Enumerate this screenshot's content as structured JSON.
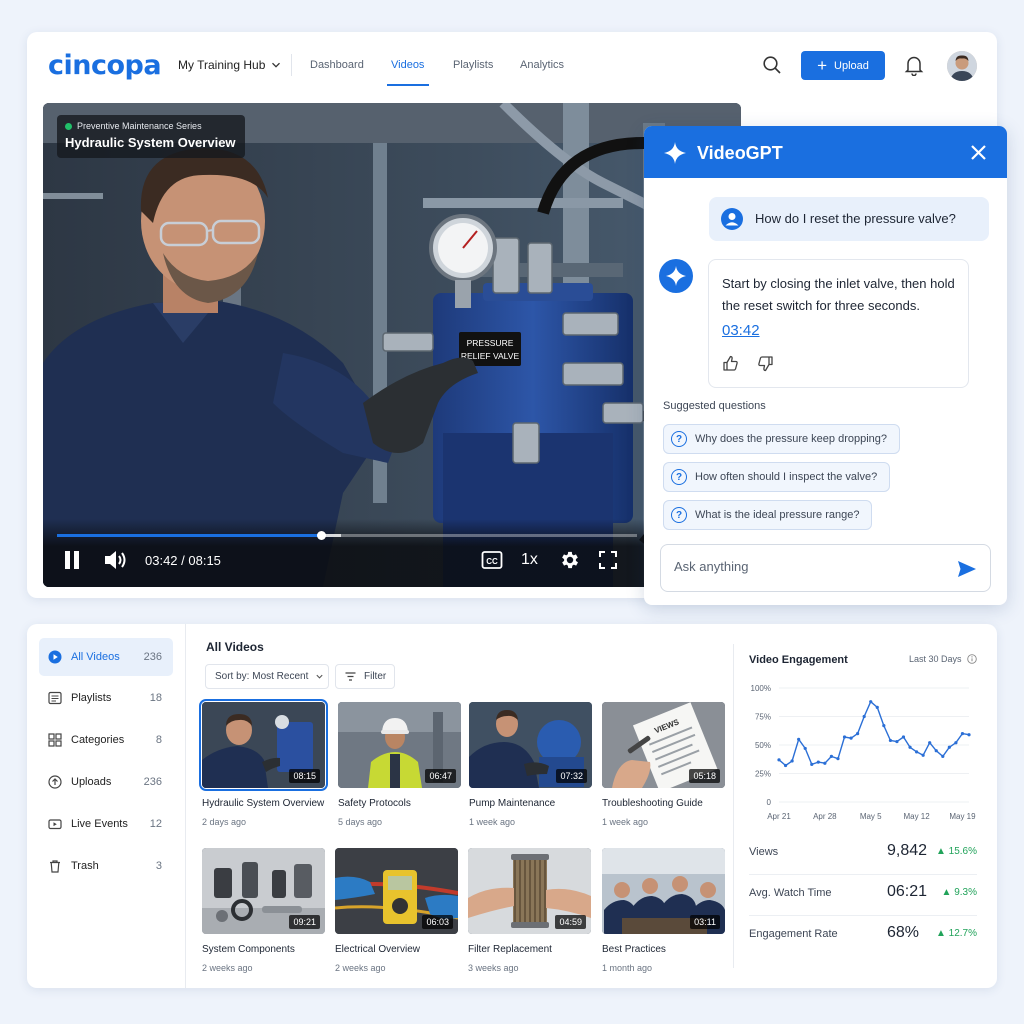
{
  "app": {
    "logo": "cincopa",
    "hub_label": "My Training Hub",
    "nav": [
      "Dashboard",
      "Videos",
      "Playlists",
      "Analytics"
    ],
    "active_nav": "Videos",
    "upload_label": "Upload"
  },
  "player": {
    "series": "Preventive Maintenance Series",
    "title": "Hydraulic System Overview",
    "scene_label": "PRESSURE\nRELIEF VALVE",
    "current_time": "03:42",
    "duration": "08:15",
    "time_display": "03:42 / 08:15",
    "progress": 0.455,
    "buffered": 0.49,
    "speed": "1x"
  },
  "videogpt": {
    "title": "VideoGPT",
    "user_question": "How do I reset the pressure valve?",
    "answer": "Start by closing the inlet valve, then hold the reset switch for three seconds.",
    "answer_timestamp": "03:42",
    "suggested_label": "Suggested questions",
    "suggestions": [
      "Why does the pressure keep dropping?",
      "How often should I inspect the valve?",
      "What is the ideal pressure range?"
    ],
    "input_placeholder": "Ask anything"
  },
  "library": {
    "sidebar": [
      {
        "label": "All Videos",
        "count": "236",
        "icon": "play-circle-icon",
        "active": true
      },
      {
        "label": "Playlists",
        "count": "18",
        "icon": "list-icon",
        "active": false
      },
      {
        "label": "Categories",
        "count": "8",
        "icon": "grid-icon",
        "active": false
      },
      {
        "label": "Uploads",
        "count": "236",
        "icon": "upload-icon",
        "active": false
      },
      {
        "label": "Live Events",
        "count": "12",
        "icon": "video-camera-icon",
        "active": false
      },
      {
        "label": "Trash",
        "count": "3",
        "icon": "trash-icon",
        "active": false
      }
    ],
    "heading": "All Videos",
    "sort_label": "Sort by: Most Recent",
    "filter_label": "Filter",
    "videos": [
      {
        "title": "Hydraulic System Overview",
        "age": "2 days ago",
        "duration": "08:15"
      },
      {
        "title": "Safety Protocols",
        "age": "5 days ago",
        "duration": "06:47"
      },
      {
        "title": "Pump Maintenance",
        "age": "1 week ago",
        "duration": "07:32"
      },
      {
        "title": "Troubleshooting Guide",
        "age": "1 week ago",
        "duration": "05:18"
      },
      {
        "title": "System Components",
        "age": "2 weeks ago",
        "duration": "09:21"
      },
      {
        "title": "Electrical Overview",
        "age": "2 weeks ago",
        "duration": "06:03"
      },
      {
        "title": "Filter Replacement",
        "age": "3 weeks ago",
        "duration": "04:59"
      },
      {
        "title": "Best Practices",
        "age": "1 month ago",
        "duration": "03:11"
      }
    ]
  },
  "engagement": {
    "title": "Video Engagement",
    "range": "Last 30 Days",
    "metrics": [
      {
        "label": "Views",
        "value": "9,842",
        "change": "▲ 15.6%"
      },
      {
        "label": "Avg. Watch Time",
        "value": "06:21",
        "change": "▲ 9.3%"
      },
      {
        "label": "Engagement Rate",
        "value": "68%",
        "change": "▲ 12.7%"
      }
    ]
  },
  "chart_data": {
    "type": "line",
    "title": "Video Engagement",
    "x_ticks": [
      "Apr 21",
      "Apr 28",
      "May 5",
      "May 12",
      "May 19"
    ],
    "y_ticks": [
      "0",
      "25%",
      "50%",
      "75%",
      "100%"
    ],
    "ylim": [
      0,
      100
    ],
    "grid": true,
    "series": [
      {
        "x": [
          "Apr 21",
          "Apr 22",
          "Apr 23",
          "Apr 24",
          "Apr 25",
          "Apr 26",
          "Apr 27",
          "Apr 28",
          "Apr 29",
          "Apr 30",
          "May 1",
          "May 2",
          "May 3",
          "May 4",
          "May 5",
          "May 6",
          "May 7",
          "May 8",
          "May 9",
          "May 10",
          "May 11",
          "May 12",
          "May 13",
          "May 14",
          "May 15",
          "May 16",
          "May 17",
          "May 18",
          "May 19",
          "May 20"
        ],
        "values": [
          37,
          32,
          36,
          55,
          47,
          33,
          35,
          34,
          40,
          38,
          57,
          56,
          60,
          75,
          88,
          83,
          67,
          54,
          53,
          57,
          48,
          44,
          41,
          52,
          45,
          40,
          48,
          52,
          60,
          59
        ]
      }
    ],
    "color": "#2b6fd6"
  }
}
